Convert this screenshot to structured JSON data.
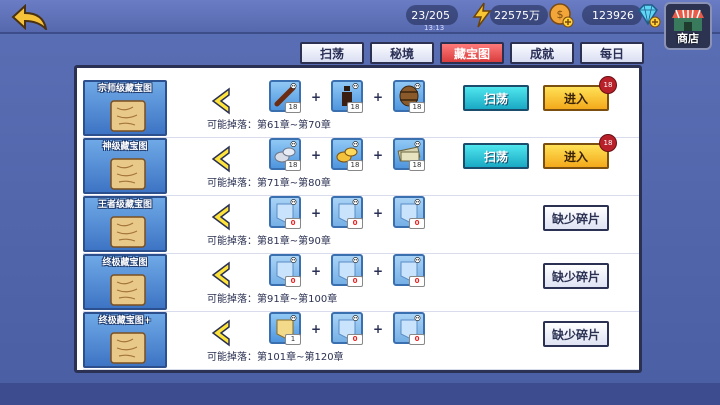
{
  "resources": {
    "stamina": "23/205",
    "stamina_sub": "13:13",
    "gold": "22575万",
    "diamonds": "123926"
  },
  "shop_label": "商店",
  "tabs": [
    {
      "label": "扫荡",
      "active": false
    },
    {
      "label": "秘境",
      "active": false
    },
    {
      "label": "藏宝图",
      "active": true
    },
    {
      "label": "成就",
      "active": false
    },
    {
      "label": "每日",
      "active": false
    }
  ],
  "rows": [
    {
      "title": "宗师级藏宝图",
      "drop": "可能掉落：第61章~第70章",
      "items": [
        {
          "name": "stick-item",
          "count": "18"
        },
        {
          "name": "bottle-item",
          "count": "18"
        },
        {
          "name": "barrel-item",
          "count": "18"
        }
      ],
      "sweep_label": "扫荡",
      "enter_label": "进入",
      "badge": "18",
      "lack_label": ""
    },
    {
      "title": "神级藏宝图",
      "drop": "可能掉落：第71章~第80章",
      "items": [
        {
          "name": "silver-item",
          "count": "18"
        },
        {
          "name": "gold-coins-item",
          "count": "18"
        },
        {
          "name": "cash-item",
          "count": "18"
        }
      ],
      "sweep_label": "扫荡",
      "enter_label": "进入",
      "badge": "18",
      "lack_label": ""
    },
    {
      "title": "王者级藏宝图",
      "drop": "可能掉落：第81章~第90章",
      "items": [
        {
          "name": "fragment-item",
          "count": "0"
        },
        {
          "name": "fragment-item",
          "count": "0"
        },
        {
          "name": "fragment-item",
          "count": "0"
        }
      ],
      "lack_label": "缺少碎片"
    },
    {
      "title": "终极藏宝图",
      "drop": "可能掉落：第91章~第100章",
      "items": [
        {
          "name": "fragment-item",
          "count": "0"
        },
        {
          "name": "fragment-item",
          "count": "0"
        },
        {
          "name": "fragment-item",
          "count": "0"
        }
      ],
      "lack_label": "缺少碎片"
    },
    {
      "title": "终极藏宝图+",
      "drop": "可能掉落：第101章~第120章",
      "items": [
        {
          "name": "fragment-item",
          "count": "1"
        },
        {
          "name": "fragment-item",
          "count": "0"
        },
        {
          "name": "fragment-item",
          "count": "0"
        }
      ],
      "lack_label": "缺少碎片"
    }
  ]
}
